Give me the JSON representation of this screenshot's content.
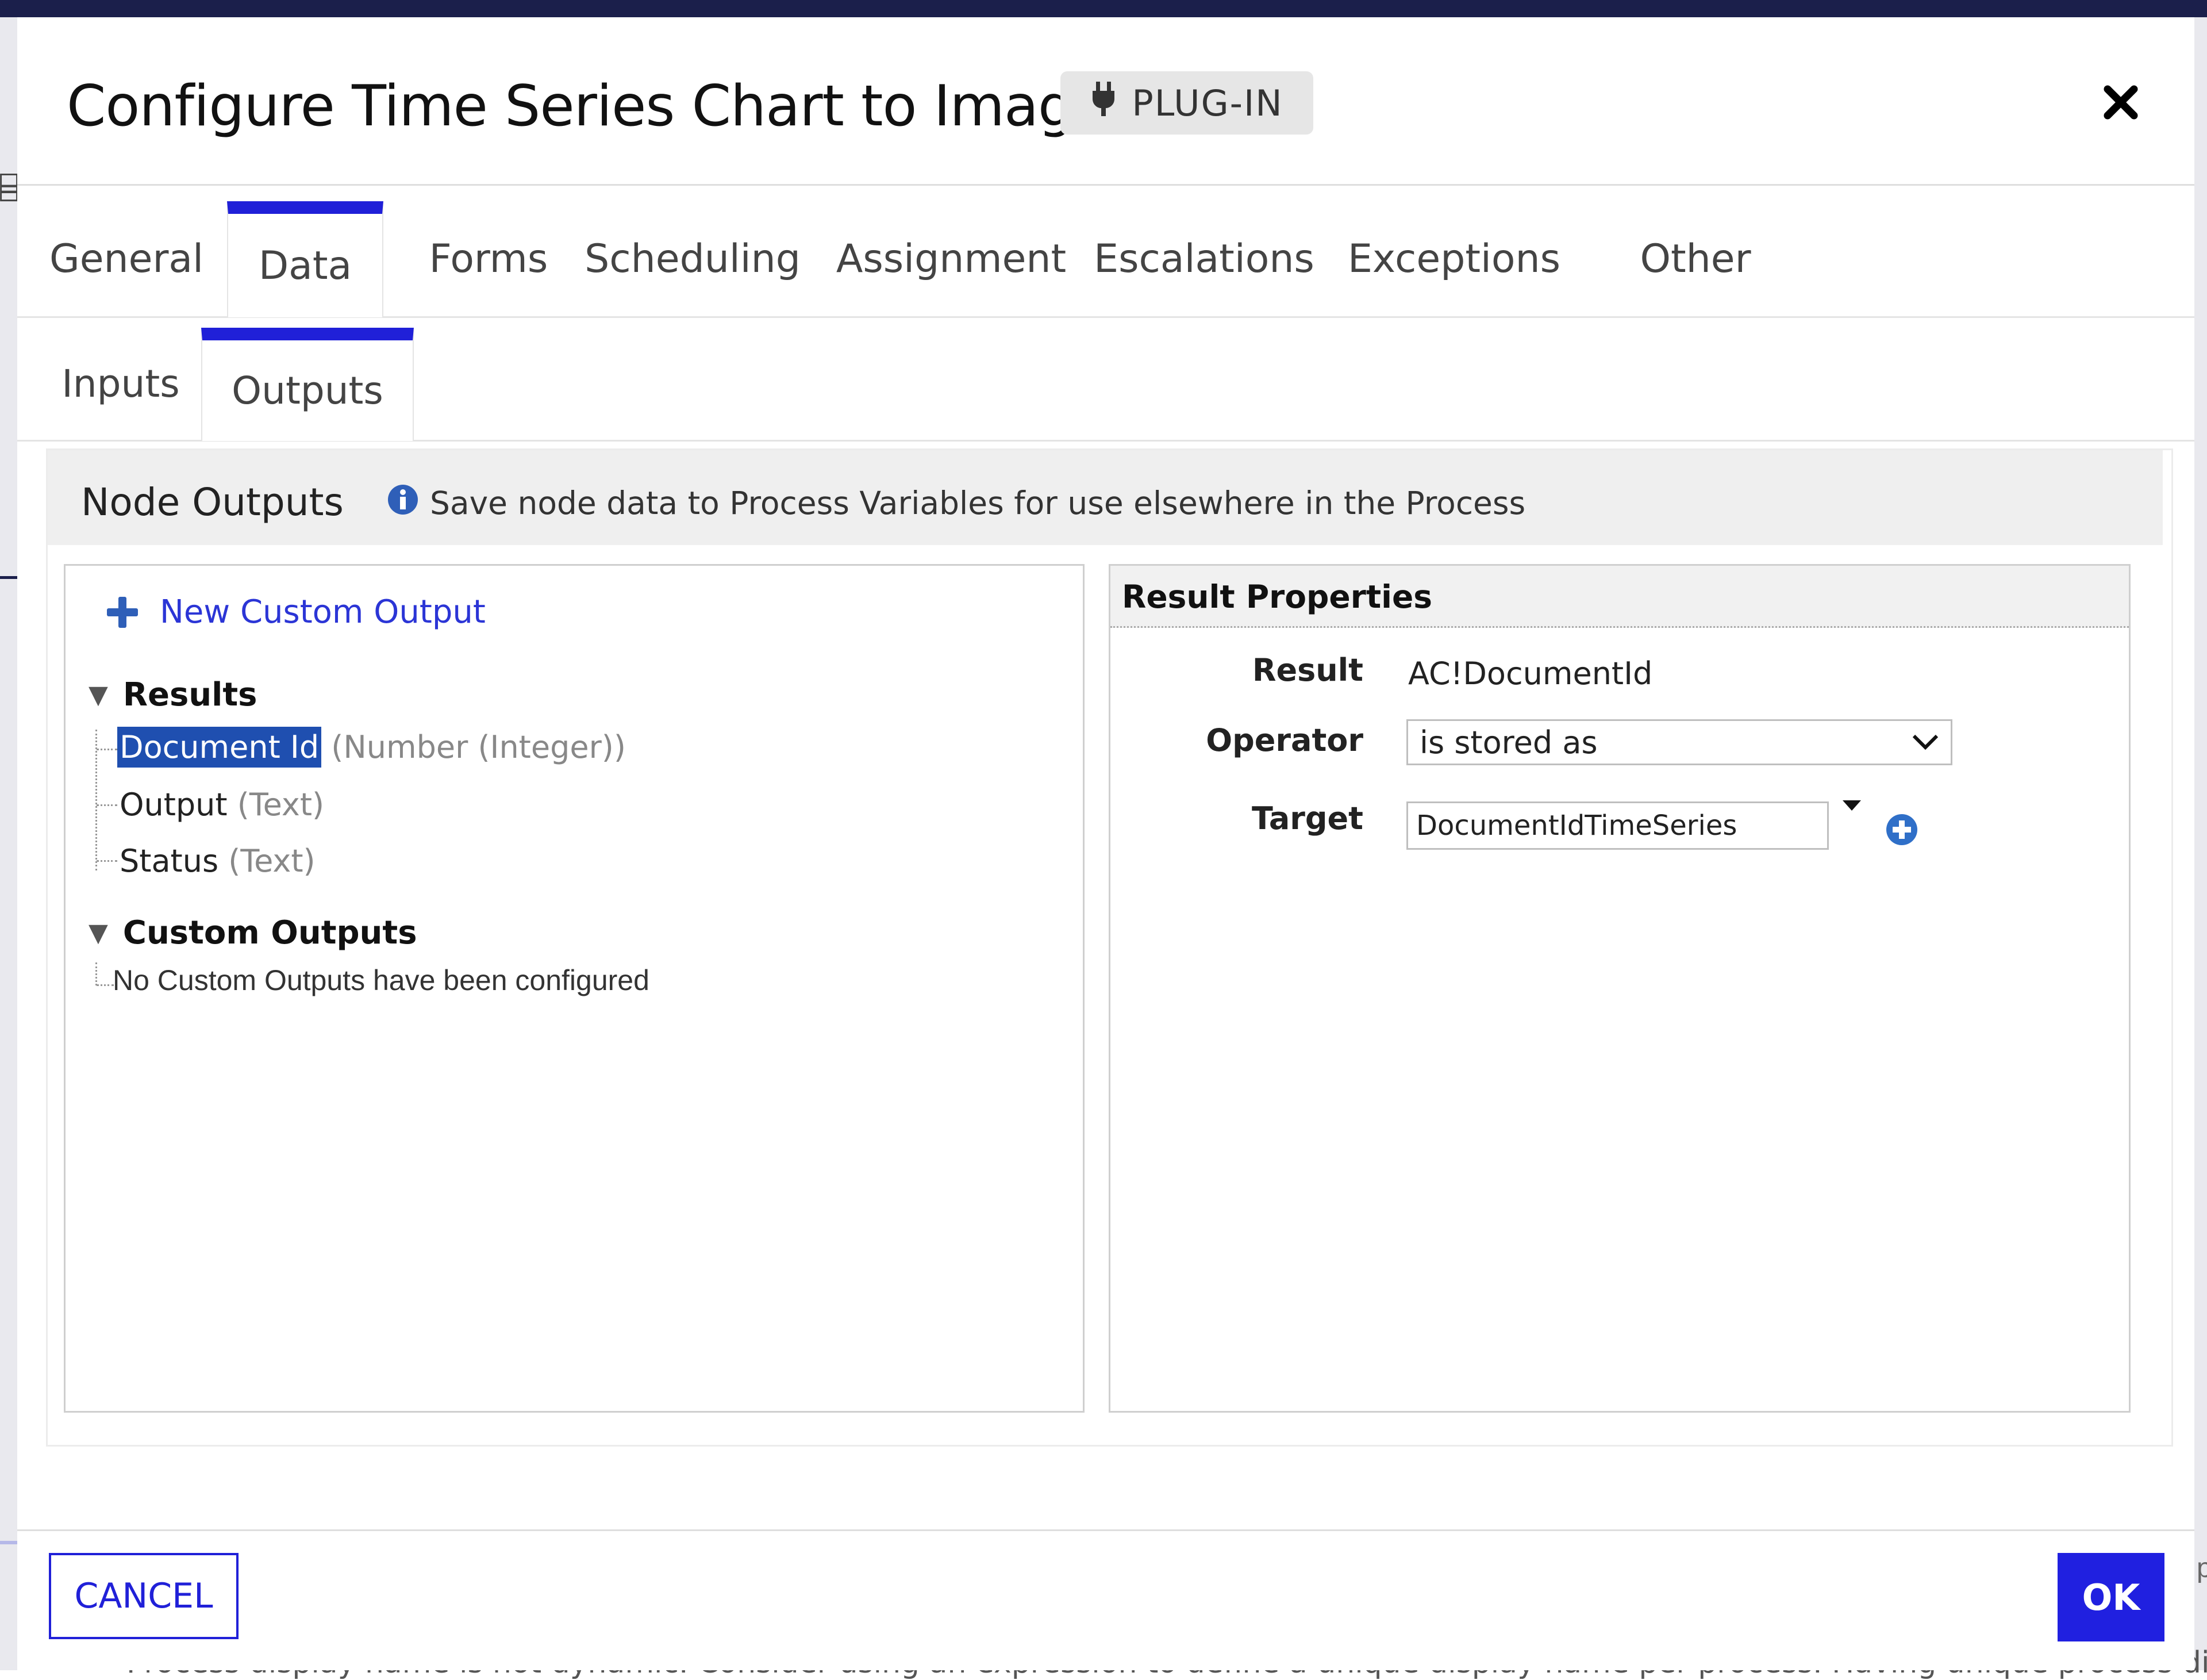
{
  "dialog": {
    "title": "Configure Time Series Chart to Image",
    "badge": "PLUG-IN",
    "badge_icon": "plug-icon",
    "close_icon": "close-icon"
  },
  "tabs": [
    {
      "label": "General",
      "active": false
    },
    {
      "label": "Data",
      "active": true
    },
    {
      "label": "Forms",
      "active": false
    },
    {
      "label": "Scheduling",
      "active": false
    },
    {
      "label": "Assignment",
      "active": false
    },
    {
      "label": "Escalations",
      "active": false
    },
    {
      "label": "Exceptions",
      "active": false
    },
    {
      "label": "Other",
      "active": false
    }
  ],
  "subtabs": [
    {
      "label": "Inputs",
      "active": false
    },
    {
      "label": "Outputs",
      "active": true
    }
  ],
  "node_outputs": {
    "title": "Node Outputs",
    "description": "Save node data to Process Variables for use elsewhere in the Process",
    "new_custom_output": "New Custom Output",
    "results_group": "Results",
    "results": [
      {
        "name": "Document Id",
        "type": "(Number (Integer))",
        "selected": true
      },
      {
        "name": "Output",
        "type": "(Text)",
        "selected": false
      },
      {
        "name": "Status",
        "type": "(Text)",
        "selected": false
      }
    ],
    "custom_group": "Custom Outputs",
    "custom_empty": "No Custom Outputs have been configured"
  },
  "result_properties": {
    "title": "Result Properties",
    "result_label": "Result",
    "result_value": "AC!DocumentId",
    "operator_label": "Operator",
    "operator_value": "is stored as",
    "target_label": "Target",
    "target_value": "DocumentIdTimeSeries"
  },
  "footer": {
    "cancel": "CANCEL",
    "ok": "OK"
  },
  "background": {
    "bottom_text": "Process display name is not dynamic. Consider using an expression to define a unique display name per process. Having unique process display n"
  },
  "colors": {
    "accent": "#2020d8",
    "selection": "#1f4fb0",
    "link": "#2b35d6"
  }
}
